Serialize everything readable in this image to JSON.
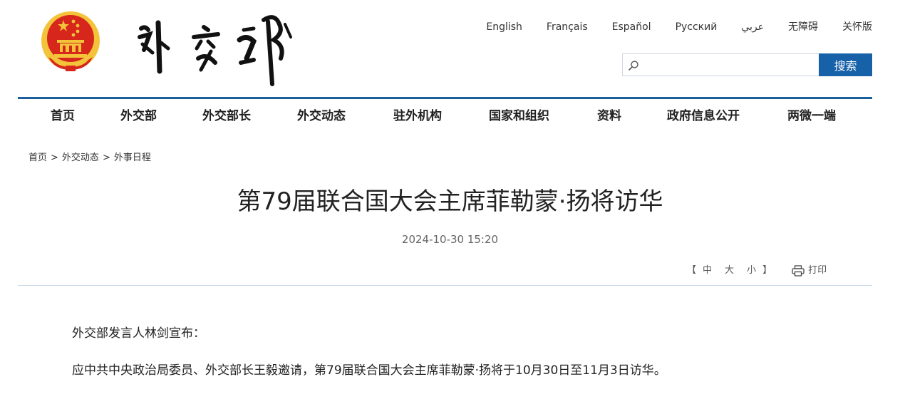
{
  "colors": {
    "primary": "#1761a8",
    "nav_line": "#1a5fa0",
    "emblem_red": "#d7261c",
    "emblem_gold": "#f3c43a"
  },
  "header": {
    "emblem_icon": "national-emblem-icon",
    "calligraphy_text": "外交部",
    "languages": [
      "English",
      "Français",
      "Español",
      "Русский",
      "عربي",
      "无障碍",
      "关怀版"
    ],
    "search": {
      "value": "",
      "placeholder": "",
      "button_label": "搜索",
      "icon": "search-icon"
    }
  },
  "nav": {
    "items": [
      "首页",
      "外交部",
      "外交部长",
      "外交动态",
      "驻外机构",
      "国家和组织",
      "资料",
      "政府信息公开",
      "两微一端"
    ]
  },
  "breadcrumb": {
    "items": [
      "首页",
      "外交动态",
      "外事日程"
    ],
    "separator": ">"
  },
  "article": {
    "title": "第79届联合国大会主席菲勒蒙·扬将访华",
    "datetime": "2024-10-30 15:20",
    "font_sizes": {
      "open": "【",
      "large": "中",
      "medium": "大",
      "small": "小",
      "close": "】"
    },
    "print_label": "打印",
    "paragraphs": [
      "外交部发言人林剑宣布：",
      "应中共中央政治局委员、外交部长王毅邀请，第79届联合国大会主席菲勒蒙·扬将于10月30日至11月3日访华。"
    ]
  }
}
